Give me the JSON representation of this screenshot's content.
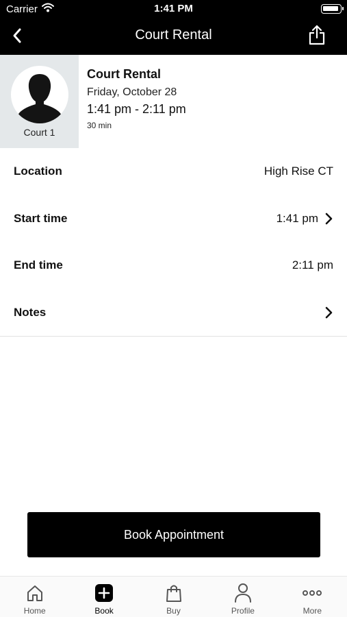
{
  "status_bar": {
    "carrier": "Carrier",
    "time": "1:41 PM"
  },
  "nav": {
    "title": "Court Rental"
  },
  "appointment": {
    "provider_name": "Court 1",
    "title": "Court Rental",
    "date": "Friday, October 28",
    "time_range": "1:41 pm - 2:11 pm",
    "duration": "30 min"
  },
  "details": {
    "location_label": "Location",
    "location_value": "High Rise CT",
    "start_label": "Start time",
    "start_value": "1:41 pm",
    "end_label": "End time",
    "end_value": "2:11 pm",
    "notes_label": "Notes"
  },
  "actions": {
    "book_label": "Book Appointment"
  },
  "tab_bar": {
    "home": "Home",
    "book": "Book",
    "buy": "Buy",
    "profile": "Profile",
    "more": "More",
    "active": "book"
  }
}
